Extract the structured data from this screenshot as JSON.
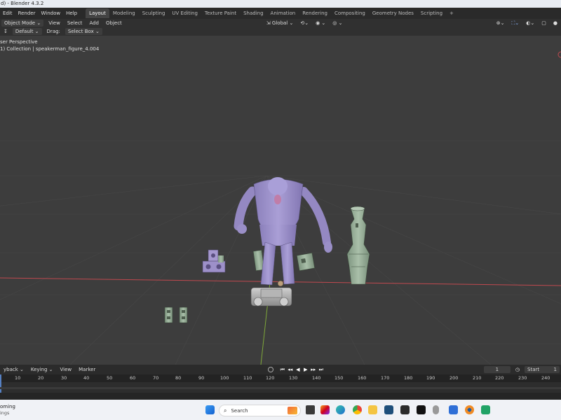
{
  "window": {
    "title": "d) - Blender 4.3.2"
  },
  "menubar": {
    "items": [
      "Edit",
      "Render",
      "Window",
      "Help"
    ],
    "workspaces": [
      "Layout",
      "Modeling",
      "Sculpting",
      "UV Editing",
      "Texture Paint",
      "Shading",
      "Animation",
      "Rendering",
      "Compositing",
      "Geometry Nodes",
      "Scripting"
    ],
    "add_tab": "+"
  },
  "header": {
    "mode": "Object Mode",
    "menus": [
      "View",
      "Select",
      "Add",
      "Object"
    ],
    "orientation": "Global"
  },
  "toolbar": {
    "orientation_label": "Default",
    "drag_label": "Drag:",
    "drag_value": "Select Box"
  },
  "viewport": {
    "view_name": "ser Perspective",
    "collection_line": "1) Collection | speakerman_figure_4.004"
  },
  "timeline": {
    "menus": [
      "yback",
      "Keying",
      "View",
      "Marker"
    ],
    "current_frame": "1",
    "start_label": "Start",
    "start_value": "1",
    "ticks": [
      "10",
      "20",
      "30",
      "40",
      "50",
      "60",
      "70",
      "80",
      "90",
      "100",
      "110",
      "120",
      "130",
      "140",
      "150",
      "160",
      "170",
      "180",
      "190",
      "200",
      "210",
      "220",
      "230",
      "240"
    ]
  },
  "taskbar": {
    "notification_line1": "oming",
    "notification_line2": "ings",
    "search_placeholder": "Search"
  },
  "colors": {
    "accent": "#5680c2",
    "figure_purple": "#9b8fc7",
    "prop_green": "#9aaf9a",
    "x_axis": "#c0494f",
    "y_axis": "#7fa83a"
  }
}
